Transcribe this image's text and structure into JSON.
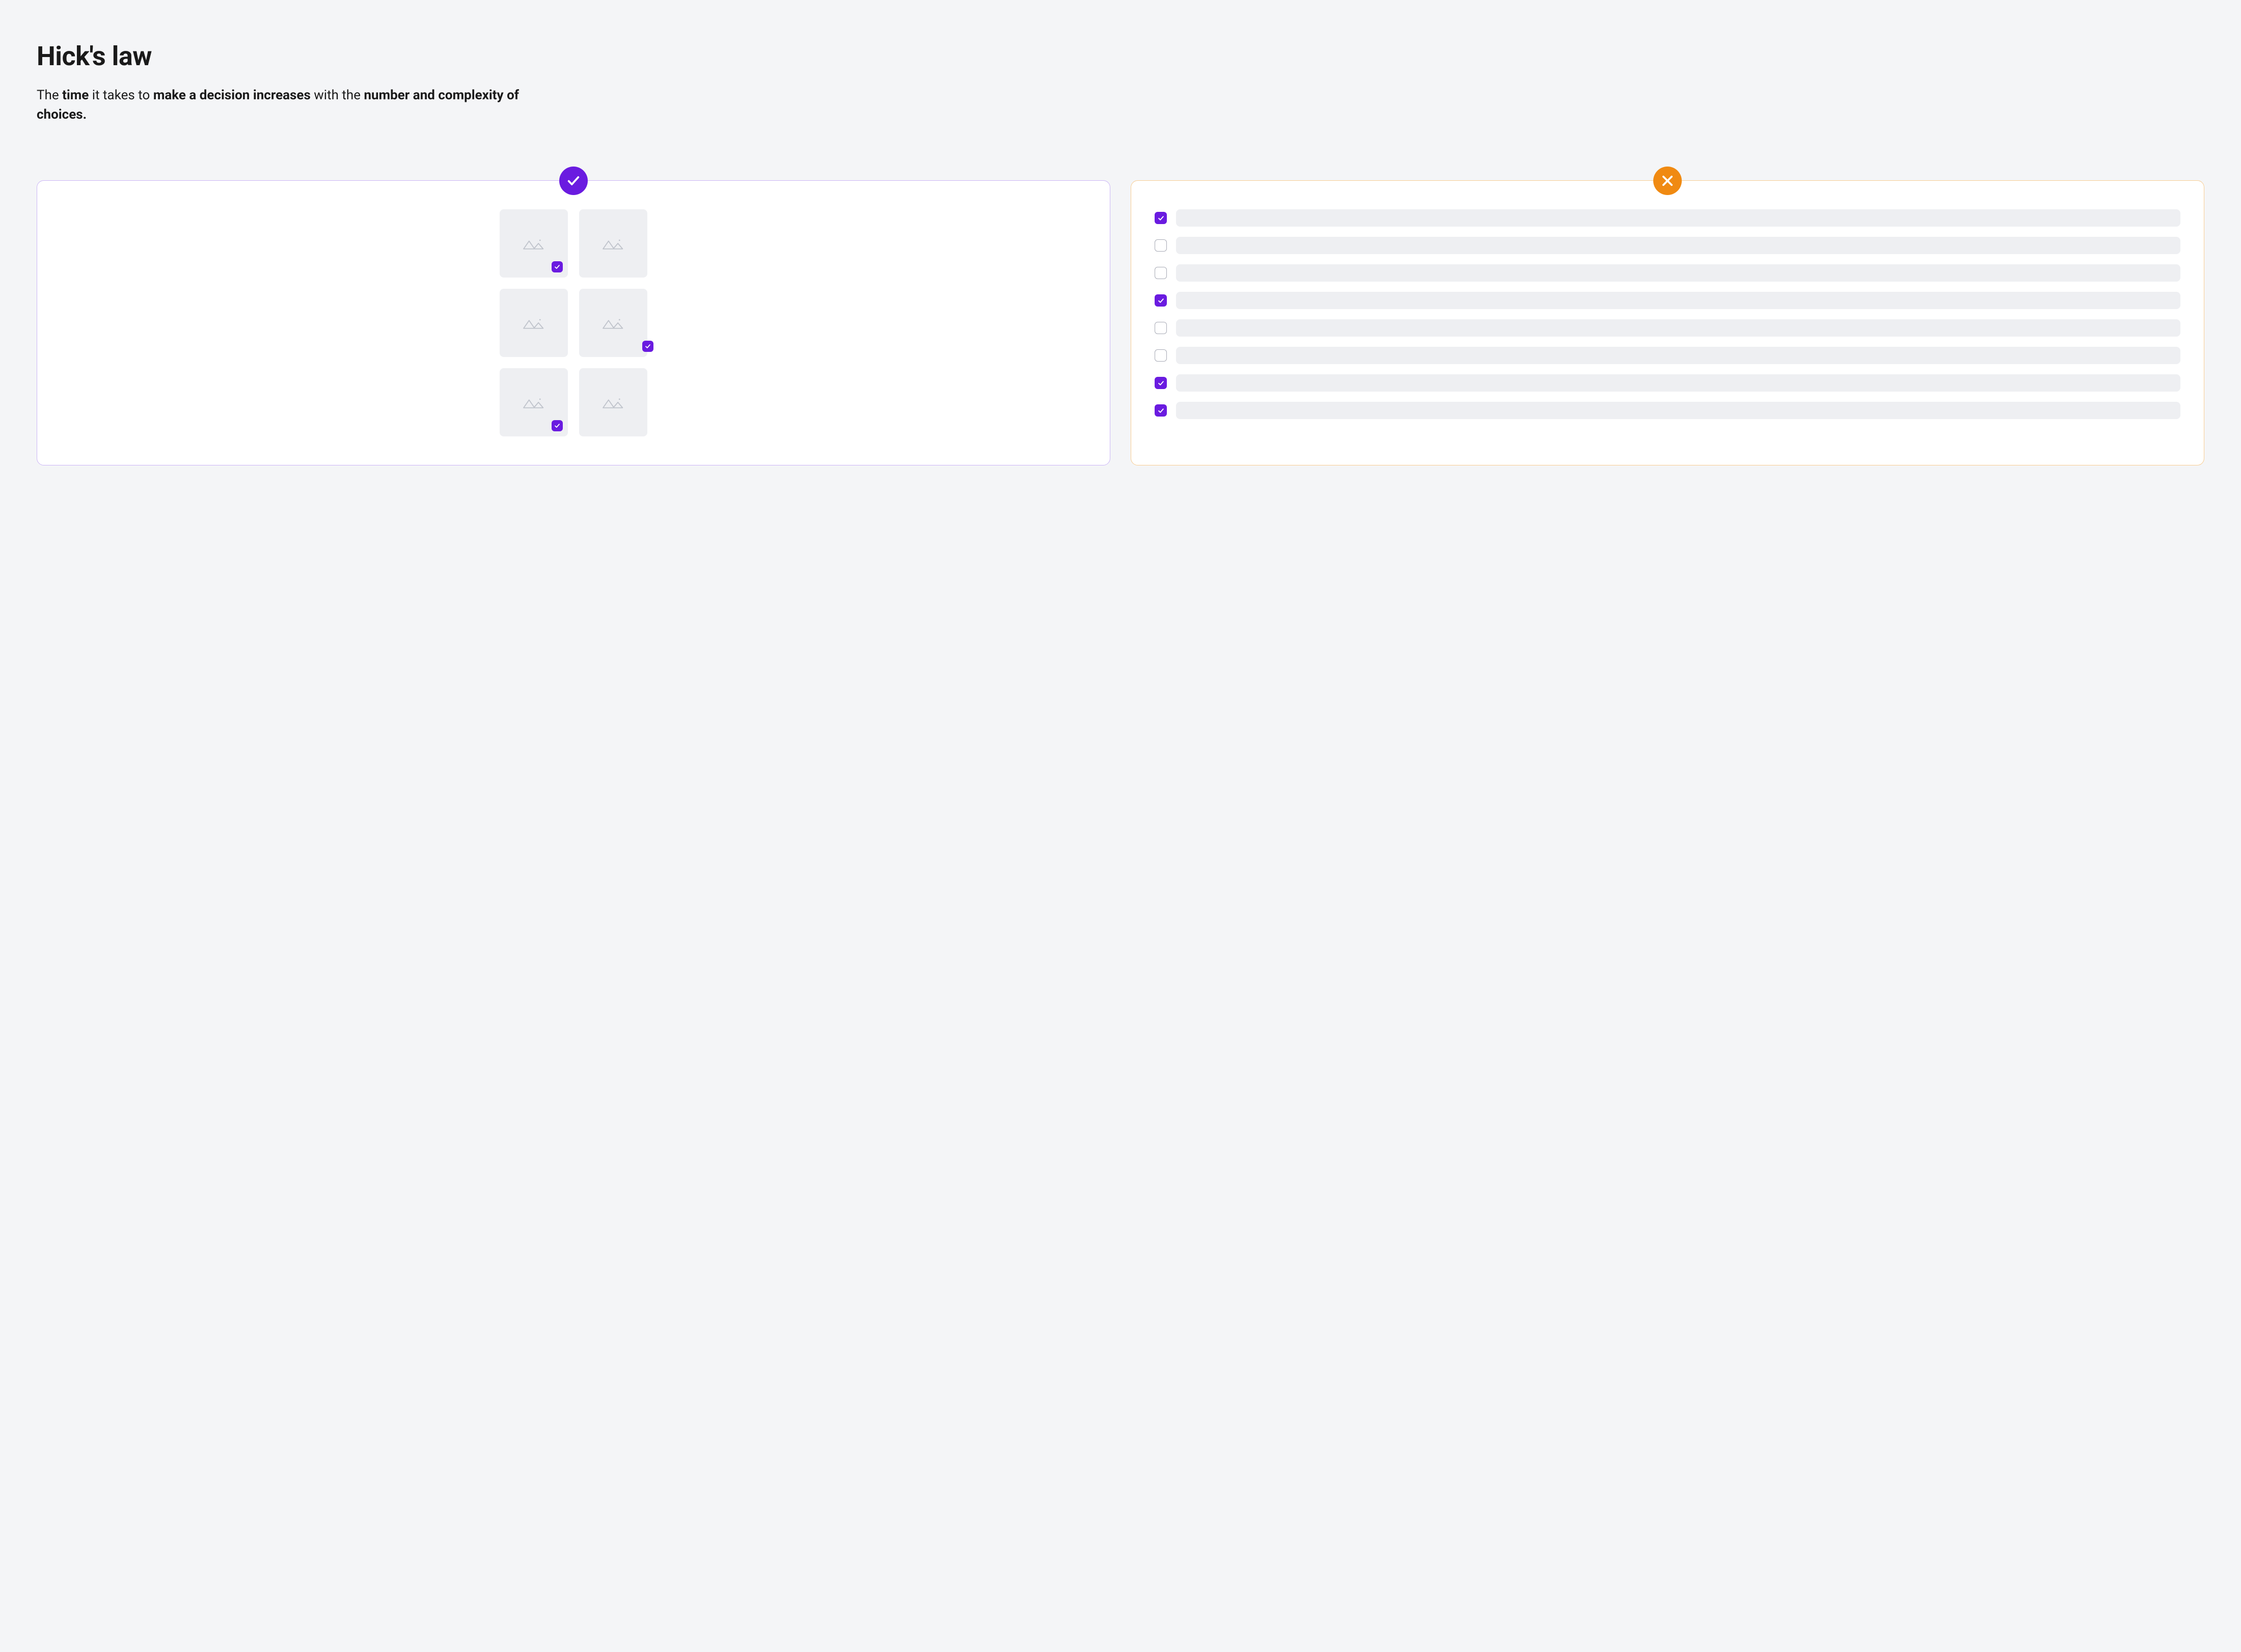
{
  "header": {
    "title": "Hick's law",
    "subtitle_parts": [
      {
        "text": "The ",
        "bold": false
      },
      {
        "text": "time",
        "bold": true
      },
      {
        "text": " it takes to ",
        "bold": false
      },
      {
        "text": "make a decision increases",
        "bold": true
      },
      {
        "text": " with the ",
        "bold": false
      },
      {
        "text": "number and complexity of choices.",
        "bold": true
      }
    ]
  },
  "colors": {
    "accent": "#6a1be0",
    "good_border": "#cbb6f6",
    "bad_border": "#f7cd93",
    "bad_badge": "#f08a12",
    "placeholder": "#eeeff2"
  },
  "good_panel": {
    "badge": "check",
    "thumbnails": [
      {
        "checked": true,
        "check_offset": false
      },
      {
        "checked": false,
        "check_offset": false
      },
      {
        "checked": false,
        "check_offset": false
      },
      {
        "checked": true,
        "check_offset": true
      },
      {
        "checked": true,
        "check_offset": false
      },
      {
        "checked": false,
        "check_offset": false
      }
    ]
  },
  "bad_panel": {
    "badge": "cross",
    "rows": [
      {
        "checked": true
      },
      {
        "checked": false
      },
      {
        "checked": false
      },
      {
        "checked": true
      },
      {
        "checked": false
      },
      {
        "checked": false
      },
      {
        "checked": true
      },
      {
        "checked": true
      }
    ]
  }
}
